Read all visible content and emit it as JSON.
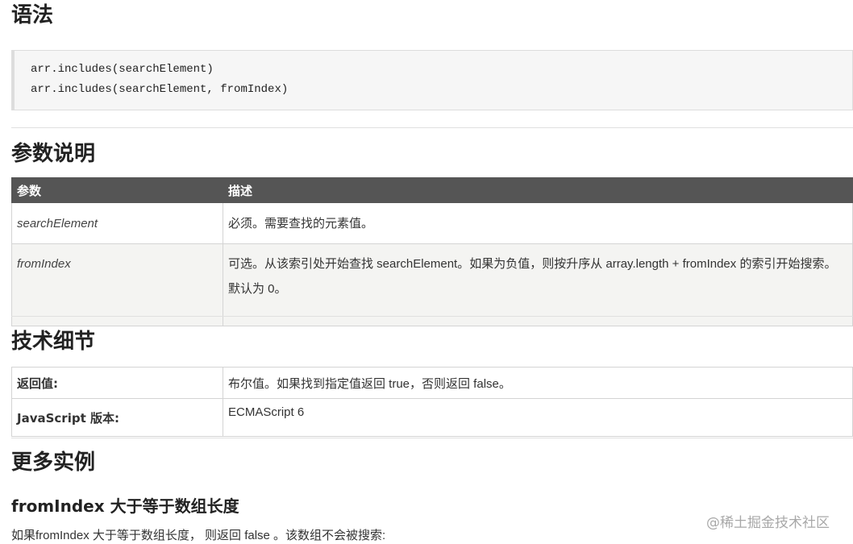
{
  "sections": {
    "syntax": "语法",
    "params": "参数说明",
    "tech": "技术细节",
    "examples": "更多实例"
  },
  "code": {
    "line1": "arr.includes(searchElement)",
    "line2": "arr.includes(searchElement, fromIndex)"
  },
  "params_table": {
    "headers": [
      "参数",
      "描述"
    ],
    "rows": [
      {
        "name": "searchElement",
        "desc": "必须。需要查找的元素值。"
      },
      {
        "name": "fromIndex",
        "desc": "可选。从该索引处开始查找 searchElement。如果为负值，则按升序从 array.length + fromIndex 的索引开始搜索。默认为 0。"
      }
    ]
  },
  "tech_table": {
    "rows": [
      {
        "key": "返回值:",
        "value": "布尔值。如果找到指定值返回 true，否则返回 false。"
      },
      {
        "key": "JavaScript 版本:",
        "value": "ECMAScript 6"
      }
    ]
  },
  "example": {
    "heading": "fromIndex 大于等于数组长度",
    "text": "如果fromIndex 大于等于数组长度， 则返回 false 。该数组不会被搜索:"
  },
  "watermark": "@稀土掘金技术社区"
}
